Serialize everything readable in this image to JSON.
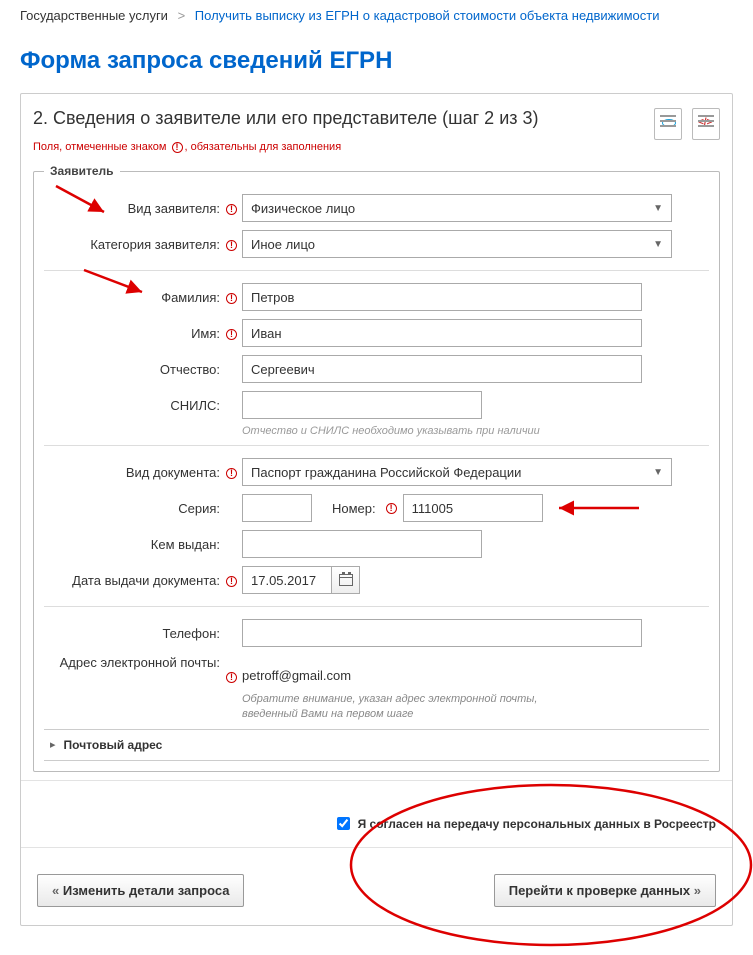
{
  "breadcrumb": {
    "home": "Государственные услуги",
    "link": "Получить выписку из ЕГРН о кадастровой стоимости объекта недвижимости"
  },
  "title": "Форма запроса сведений ЕГРН",
  "step_title": "2. Сведения о заявителе или его представителе (шаг 2 из 3)",
  "required_note_prefix": "Поля, отмеченные знаком",
  "required_note_suffix": "обязательны для заполнения",
  "fieldset_legend": "Заявитель",
  "labels": {
    "applicant_type": "Вид заявителя:",
    "applicant_category": "Категория заявителя:",
    "lastname": "Фамилия:",
    "firstname": "Имя:",
    "middlename": "Отчество:",
    "snils": "СНИЛС:",
    "doc_type": "Вид документа:",
    "series": "Серия:",
    "number": "Номер:",
    "issued_by": "Кем выдан:",
    "issue_date": "Дата выдачи документа:",
    "phone": "Телефон:",
    "email": "Адрес электронной почты:"
  },
  "values": {
    "applicant_type": "Физическое лицо",
    "applicant_category": "Иное лицо",
    "lastname": "Петров",
    "firstname": "Иван",
    "middlename": "Сергеевич",
    "snils": "",
    "doc_type": "Паспорт гражданина Российской Федерации",
    "series": "",
    "number": "111005",
    "issued_by": "",
    "issue_date": "17.05.2017",
    "phone": "",
    "email": "petroff@gmail.com"
  },
  "hints": {
    "mid_snils": "Отчество и СНИЛС необходимо указывать при наличии",
    "email": "Обратите внимание, указан адрес электронной почты, введенный Вами на первом шаге"
  },
  "accordion": {
    "postal": "Почтовый адрес"
  },
  "consent_label": "Я согласен на передачу персональных данных в Росреестр",
  "buttons": {
    "back": "Изменить детали запроса",
    "next": "Перейти к проверке данных"
  }
}
